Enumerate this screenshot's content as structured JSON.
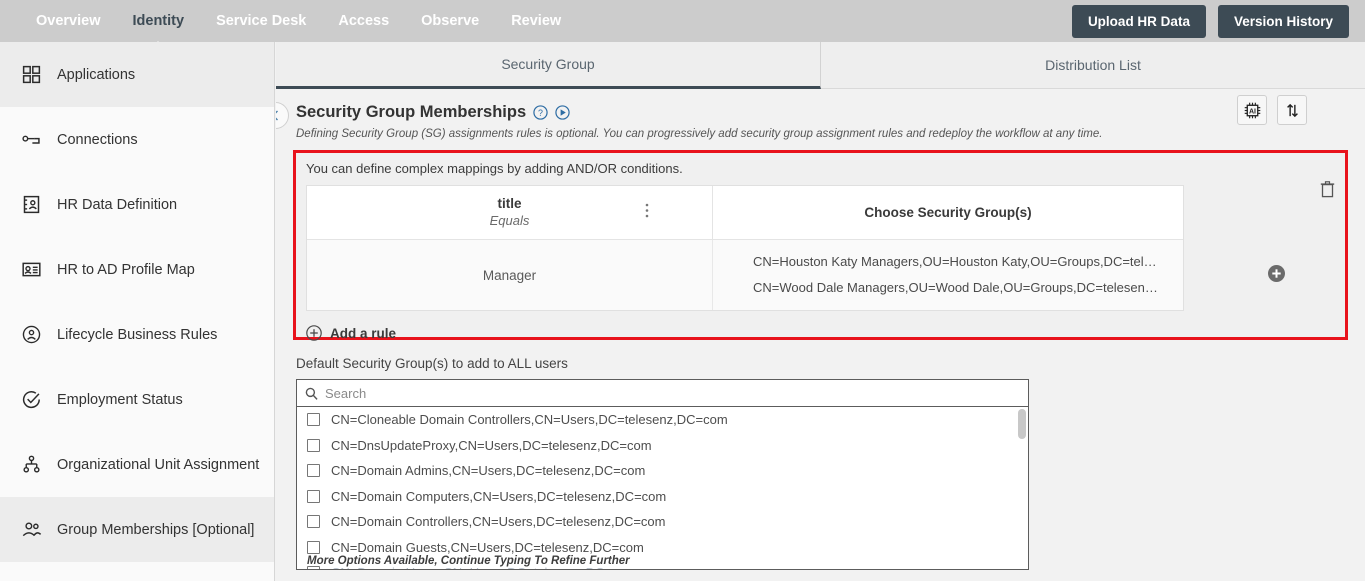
{
  "topnav": {
    "links": [
      {
        "label": "Overview",
        "active": false
      },
      {
        "label": "Identity",
        "active": true
      },
      {
        "label": "Service Desk",
        "active": false
      },
      {
        "label": "Access",
        "active": false
      },
      {
        "label": "Observe",
        "active": false
      },
      {
        "label": "Review",
        "active": false
      }
    ],
    "upload_button": "Upload HR Data",
    "version_button": "Version History",
    "bg_color": "#cccccc",
    "button_color": "#3d4b55"
  },
  "sidebar": {
    "items": [
      {
        "label": "Applications",
        "icon": "grid-icon",
        "selected": true
      },
      {
        "label": "Connections",
        "icon": "connection-icon",
        "selected": false
      },
      {
        "label": "HR Data Definition",
        "icon": "hr-data-icon",
        "selected": false
      },
      {
        "label": "HR to AD Profile Map",
        "icon": "profile-map-icon",
        "selected": false
      },
      {
        "label": "Lifecycle Business Rules",
        "icon": "lifecycle-icon",
        "selected": false
      },
      {
        "label": "Employment Status",
        "icon": "check-circle-icon",
        "selected": false
      },
      {
        "label": "Organizational Unit Assignment",
        "icon": "org-unit-icon",
        "selected": false
      },
      {
        "label": "Group Memberships [Optional]",
        "icon": "group-icon",
        "selected": true
      }
    ]
  },
  "tabs": [
    {
      "label": "Security Group",
      "active": true
    },
    {
      "label": "Distribution List",
      "active": false
    }
  ],
  "header": {
    "title": "Security Group Memberships",
    "help_icon": "question-circle-icon",
    "play_icon": "play-circle-icon",
    "subtitle": "Defining Security Group (SG) assignments rules is optional.  You can progressively add security group assignment rules and redeploy the workflow at any time.",
    "ai_button_label": "AI",
    "sort_icon": "sort-arrows-icon",
    "back_icon": "chevron-left-icon"
  },
  "rule_card": {
    "hint": "You can define complex mappings by adding AND/OR conditions.",
    "border_color": "#e8131c",
    "columns": {
      "attribute": "title",
      "operator": "Equals",
      "groups_header": "Choose Security Group(s)"
    },
    "kebab_icon": "more-vertical-icon",
    "delete_icon": "trash-icon",
    "add_group_icon": "plus-circle-filled-icon",
    "rows": [
      {
        "value": "Manager",
        "groups": [
          "CN=Houston Katy Managers,OU=Houston Katy,OU=Groups,DC=tel…",
          "CN=Wood Dale Managers,OU=Wood Dale,OU=Groups,DC=telesen…"
        ]
      }
    ],
    "add_rule_label": "Add a rule",
    "add_rule_icon": "plus-circle-icon"
  },
  "default_groups": {
    "label": "Default Security Group(s) to add to ALL users",
    "search_placeholder": "Search",
    "search_value": "",
    "search_icon": "search-icon",
    "more_options_note": "More Options Available, Continue Typing To Refine Further",
    "options": [
      {
        "label": "CN=Cloneable Domain Controllers,CN=Users,DC=telesenz,DC=com",
        "checked": false
      },
      {
        "label": "CN=DnsUpdateProxy,CN=Users,DC=telesenz,DC=com",
        "checked": false
      },
      {
        "label": "CN=Domain Admins,CN=Users,DC=telesenz,DC=com",
        "checked": false
      },
      {
        "label": "CN=Domain Computers,CN=Users,DC=telesenz,DC=com",
        "checked": false
      },
      {
        "label": "CN=Domain Controllers,CN=Users,DC=telesenz,DC=com",
        "checked": false
      },
      {
        "label": "CN=Domain Guests,CN=Users,DC=telesenz,DC=com",
        "checked": false
      },
      {
        "label": "CN=Domain Users,CN=Users,DC=telesenz,DC=com",
        "checked": false
      }
    ]
  }
}
